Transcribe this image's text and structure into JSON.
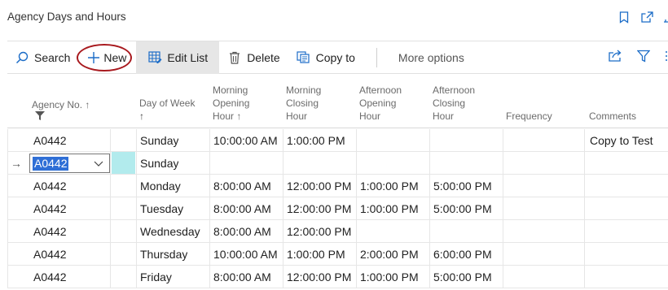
{
  "page": {
    "title": "Agency Days and Hours",
    "header_icons": [
      "bookmark-icon",
      "open-new-window-icon",
      "collapse-icon"
    ]
  },
  "actions": {
    "search": "Search",
    "new": "New",
    "edit_list": "Edit List",
    "delete": "Delete",
    "copy_to": "Copy to",
    "more_options": "More options",
    "right_icons": [
      "share-icon",
      "filter-icon",
      "more-vertical-icon"
    ]
  },
  "columns": {
    "agency_no": "Agency No. ↑",
    "day_of_week": "Day of Week",
    "day_of_week_sort": "↑",
    "morning_opening": [
      "Morning",
      "Opening",
      "Hour ↑"
    ],
    "morning_closing": [
      "Morning",
      "Closing",
      "Hour"
    ],
    "afternoon_opening": [
      "Afternoon",
      "Opening",
      "Hour"
    ],
    "afternoon_closing": [
      "Afternoon",
      "Closing",
      "Hour"
    ],
    "frequency": "Frequency",
    "comments": "Comments"
  },
  "rows": [
    {
      "agency": "A0442",
      "day": "Sunday",
      "mo": "10:00:00 AM",
      "mc": "1:00:00 PM",
      "ao": "",
      "ac": "",
      "freq": "",
      "comments": "Copy to Test"
    },
    {
      "agency": "A0442",
      "day": "Sunday",
      "mo": "",
      "mc": "",
      "ao": "",
      "ac": "",
      "freq": "",
      "comments": "",
      "editing": true,
      "indicator": "→"
    },
    {
      "agency": "A0442",
      "day": "Monday",
      "mo": "8:00:00 AM",
      "mc": "12:00:00 PM",
      "ao": "1:00:00 PM",
      "ac": "5:00:00 PM",
      "freq": "",
      "comments": ""
    },
    {
      "agency": "A0442",
      "day": "Tuesday",
      "mo": "8:00:00 AM",
      "mc": "12:00:00 PM",
      "ao": "1:00:00 PM",
      "ac": "5:00:00 PM",
      "freq": "",
      "comments": ""
    },
    {
      "agency": "A0442",
      "day": "Wednesday",
      "mo": "8:00:00 AM",
      "mc": "12:00:00 PM",
      "ao": "",
      "ac": "",
      "freq": "",
      "comments": ""
    },
    {
      "agency": "A0442",
      "day": "Thursday",
      "mo": "10:00:00 AM",
      "mc": "1:00:00 PM",
      "ao": "2:00:00 PM",
      "ac": "6:00:00 PM",
      "freq": "",
      "comments": ""
    },
    {
      "agency": "A0442",
      "day": "Friday",
      "mo": "8:00:00 AM",
      "mc": "12:00:00 PM",
      "ao": "1:00:00 PM",
      "ac": "5:00:00 PM",
      "freq": "",
      "comments": ""
    }
  ],
  "colors": {
    "accent": "#2f6fd6",
    "highlight_ring": "#a8191e",
    "active_cell": "#b2ebed",
    "icon": "#1b6cc7"
  }
}
